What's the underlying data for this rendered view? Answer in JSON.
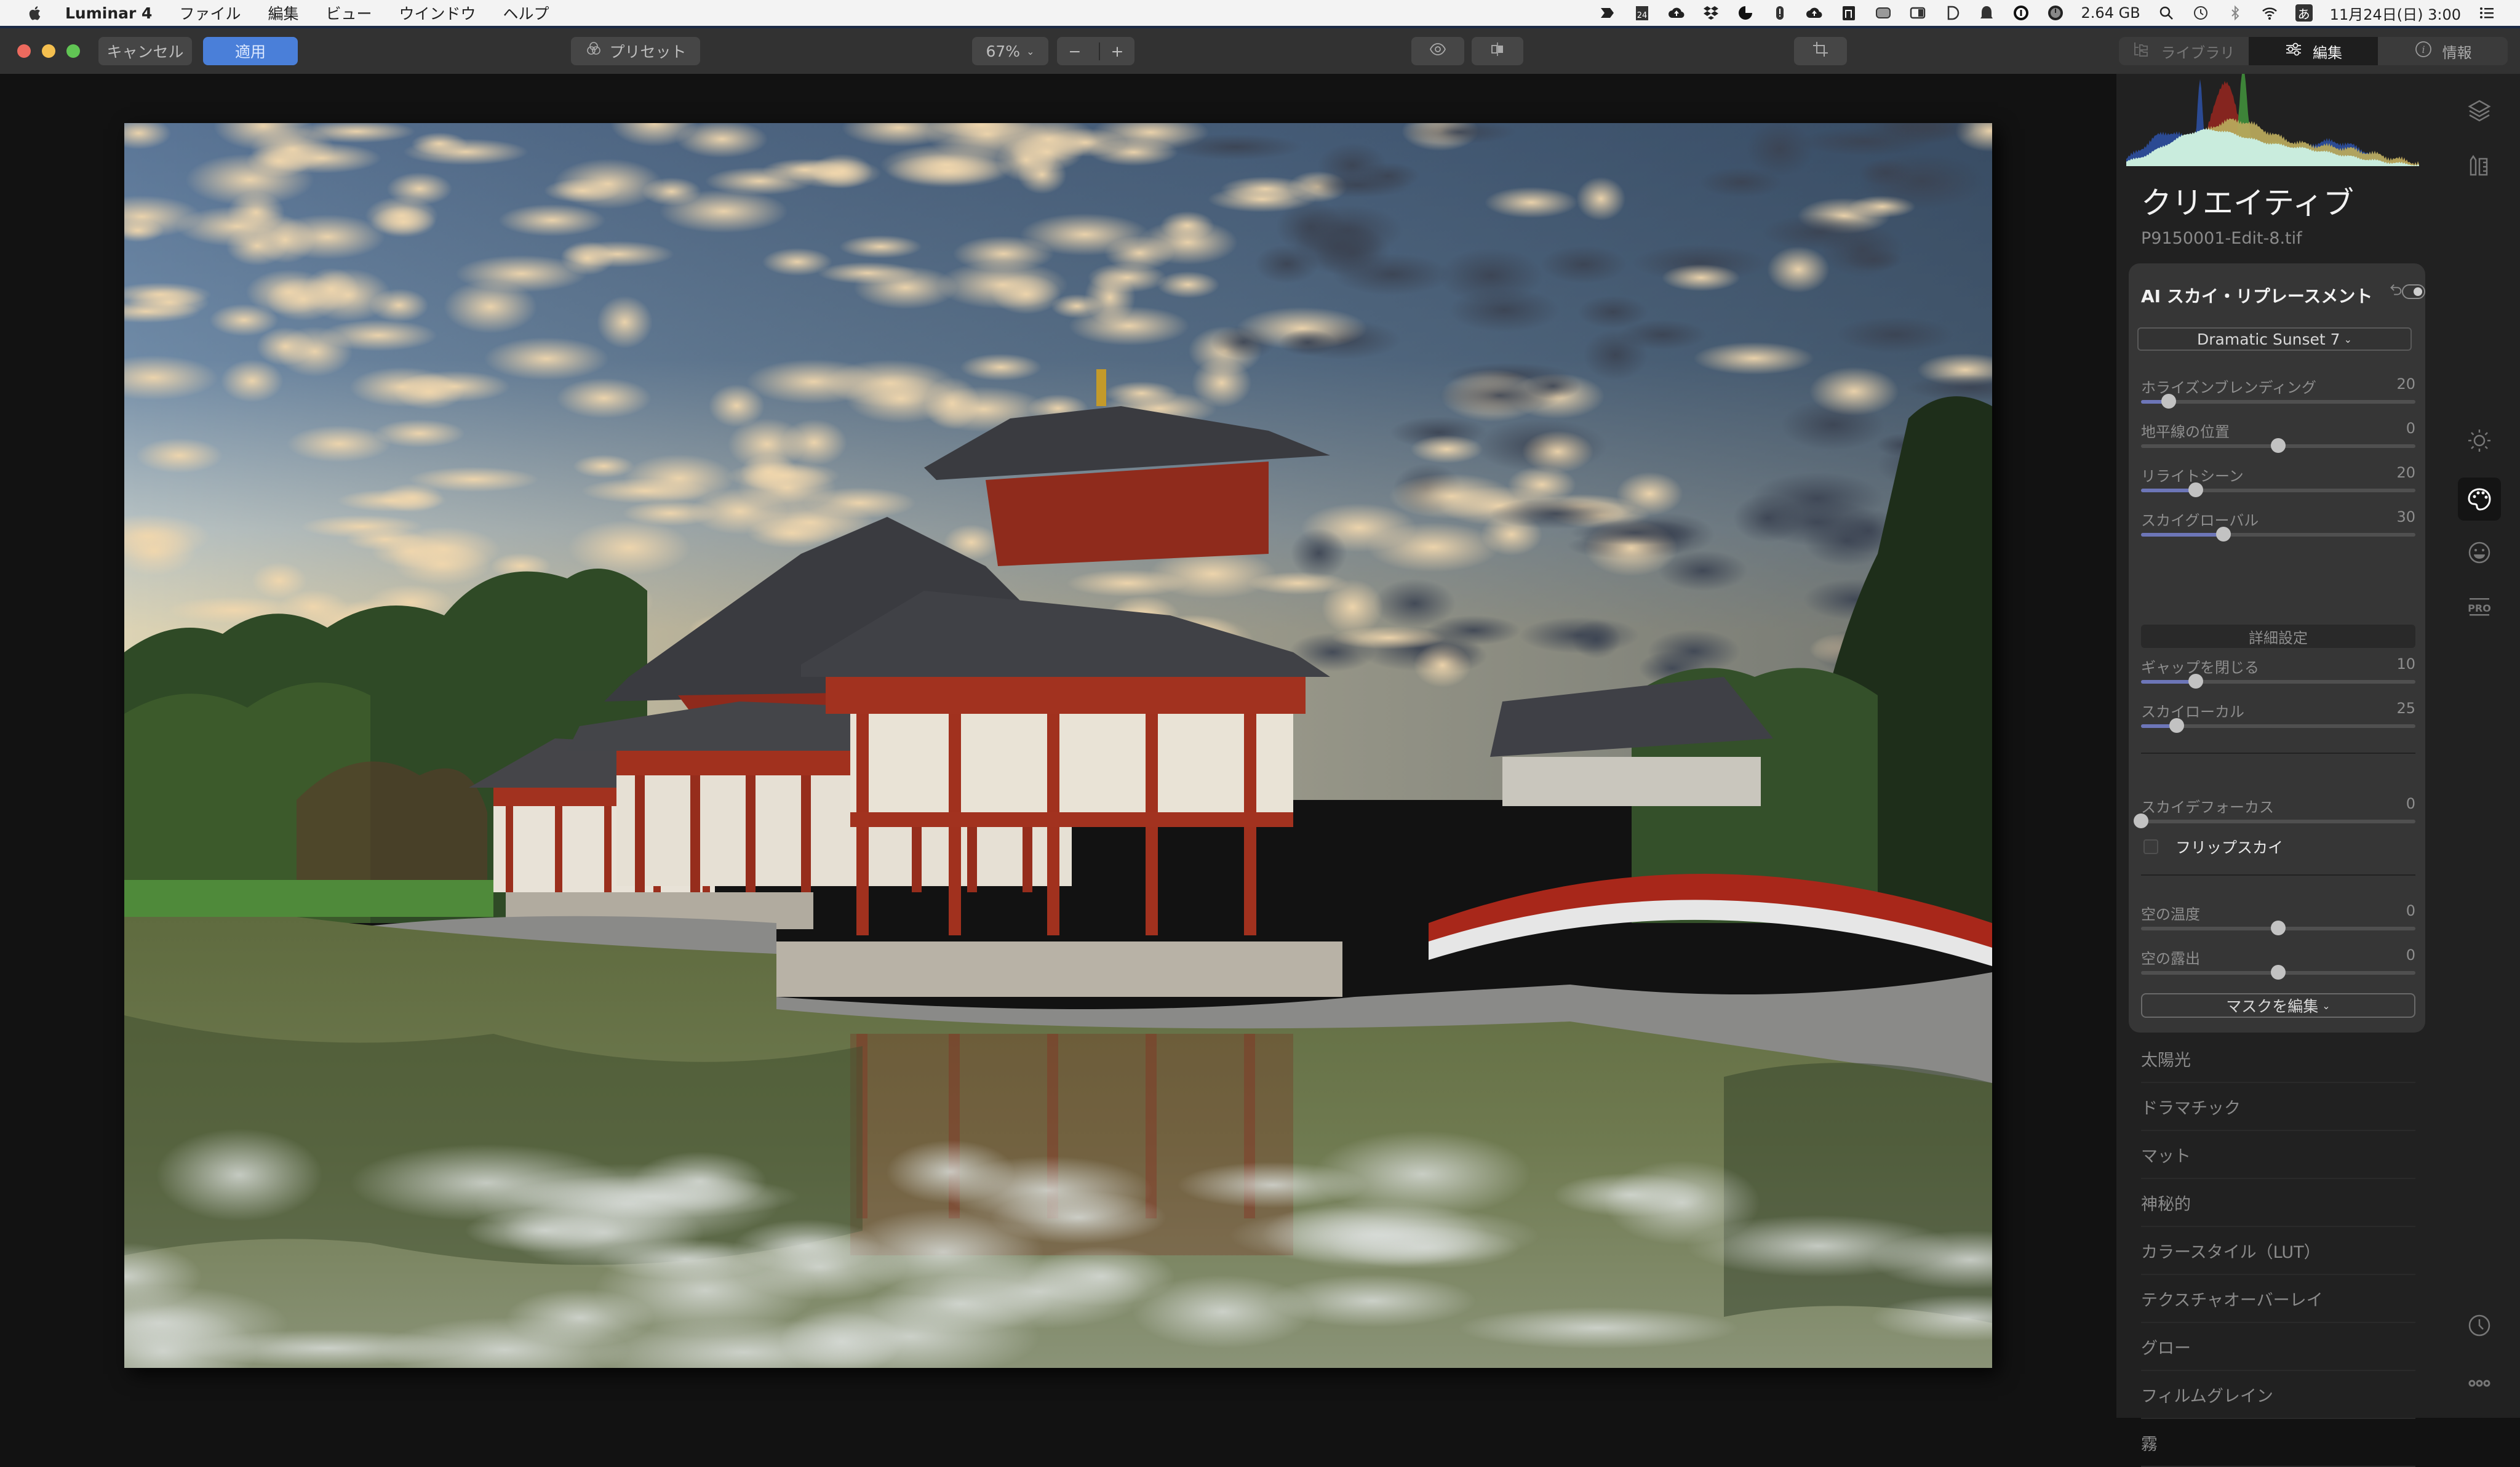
{
  "menubar": {
    "app_name": "Luminar 4",
    "menus": [
      "ファイル",
      "編集",
      "ビュー",
      "ウインドウ",
      "ヘルプ"
    ],
    "status_icons": [
      "forward-icon",
      "calendar-icon",
      "cloud-upload-icon",
      "dropbox-icon",
      "pie-icon",
      "location-icon",
      "cloud-upload-icon",
      "app-icon",
      "battery-icon",
      "display-icon",
      "d-icon",
      "bell-icon",
      "info-icon",
      "disk-icon"
    ],
    "calendar_day": "24",
    "memory": "2.64 GB",
    "ime": "あ",
    "datetime": "11月24日(日) 3:00"
  },
  "toolbar": {
    "cancel_label": "キャンセル",
    "apply_label": "適用",
    "presets_label": "プリセット",
    "zoom_value": "67%",
    "zoom_out_label": "−",
    "zoom_in_label": "+",
    "tabs": [
      {
        "label": "ライブラリ",
        "icon": "library-icon",
        "active": false
      },
      {
        "label": "編集",
        "icon": "sliders-icon",
        "active": true
      },
      {
        "label": "情報",
        "icon": "info-icon",
        "active": false
      }
    ]
  },
  "colors": {
    "accent": "#4a7fd9",
    "slider_fill": "#6d76b8",
    "panel_bg": "#212121",
    "card_bg": "#363636"
  },
  "panel": {
    "title": "クリエイティブ",
    "filename": "P9150001-Edit-8.tif",
    "module": {
      "title": "AI スカイ・リプレースメント",
      "enabled": true,
      "sky_preset": "Dramatic Sunset 7",
      "sliders_primary": [
        {
          "label": "ホライズンブレンディング",
          "value": "20",
          "fraction": 0.1,
          "bipolar": false
        },
        {
          "label": "地平線の位置",
          "value": "0",
          "fraction": 0.5,
          "bipolar": true
        },
        {
          "label": "リライトシーン",
          "value": "20",
          "fraction": 0.2,
          "bipolar": false
        },
        {
          "label": "スカイグローバル",
          "value": "30",
          "fraction": 0.3,
          "bipolar": false
        }
      ],
      "advanced_label": "詳細設定",
      "sliders_advanced": [
        {
          "label": "ギャップを閉じる",
          "value": "10",
          "fraction": 0.2,
          "bipolar": false
        },
        {
          "label": "スカイローカル",
          "value": "25",
          "fraction": 0.13,
          "bipolar": false
        }
      ],
      "defocus": {
        "label": "スカイデフォーカス",
        "value": "0",
        "fraction": 0,
        "bipolar": false
      },
      "flip_sky": {
        "label": "フリップスカイ",
        "checked": false
      },
      "sliders_sky": [
        {
          "label": "空の温度",
          "value": "0",
          "fraction": 0.5,
          "bipolar": true
        },
        {
          "label": "空の露出",
          "value": "0",
          "fraction": 0.5,
          "bipolar": true
        }
      ],
      "edit_mask_label": "マスクを編集"
    },
    "tools": [
      "太陽光",
      "ドラマチック",
      "マット",
      "神秘的",
      "カラースタイル（LUT）",
      "テクスチャオーバーレイ",
      "グロー",
      "フィルムグレイン",
      "霧"
    ]
  },
  "icon_strip": [
    {
      "name": "layers-icon"
    },
    {
      "name": "canvas-icon"
    },
    {
      "name": "essentials-sun-icon"
    },
    {
      "name": "creative-palette-icon",
      "active": true
    },
    {
      "name": "portrait-face-icon"
    },
    {
      "name": "pro-icon",
      "text": "PRO"
    },
    {
      "name": "history-clock-icon"
    },
    {
      "name": "more-icon"
    }
  ],
  "photo": {
    "description": "Byodo-in Phoenix Hall with dramatic sunset sky reflected in pond"
  }
}
